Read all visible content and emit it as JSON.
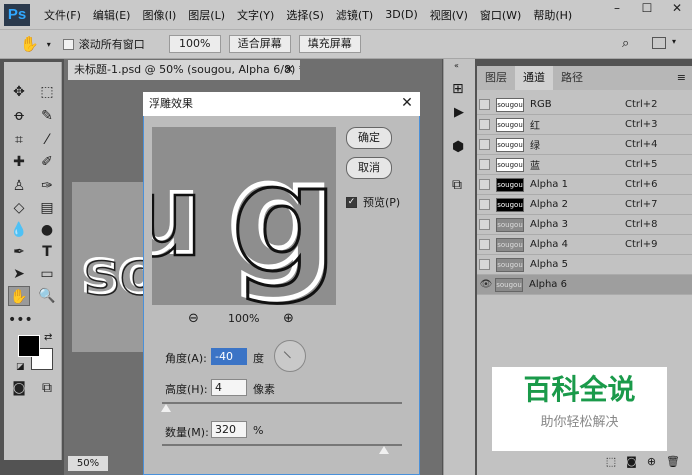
{
  "menubar": {
    "logo": "Ps",
    "items": [
      "文件(F)",
      "编辑(E)",
      "图像(I)",
      "图层(L)",
      "文字(Y)",
      "选择(S)",
      "滤镜(T)",
      "3D(D)",
      "视图(V)",
      "窗口(W)",
      "帮助(H)"
    ],
    "window_controls": {
      "minimize": "–",
      "maximize": "☐",
      "close": "✕"
    }
  },
  "options_bar": {
    "scroll_all_label": "滚动所有窗口",
    "zoom_value": "100%",
    "fit_screen": "适合屏幕",
    "fill_screen": "填充屏幕"
  },
  "document": {
    "tab_title": "未标题-1.psd @ 50% (sougou, Alpha 6/8) *",
    "zoom_status": "50%"
  },
  "channels_panel": {
    "tabs": [
      "图层",
      "通道",
      "路径"
    ],
    "active_tab": "通道",
    "channels": [
      {
        "name": "RGB",
        "shortcut": "Ctrl+2",
        "thumb": "sougou"
      },
      {
        "name": "红",
        "shortcut": "Ctrl+3",
        "thumb": "sougou"
      },
      {
        "name": "绿",
        "shortcut": "Ctrl+4",
        "thumb": "sougou"
      },
      {
        "name": "蓝",
        "shortcut": "Ctrl+5",
        "thumb": "sougou"
      },
      {
        "name": "Alpha 1",
        "shortcut": "Ctrl+6",
        "thumb": "sougou"
      },
      {
        "name": "Alpha 2",
        "shortcut": "Ctrl+7",
        "thumb": "sougou"
      },
      {
        "name": "Alpha 3",
        "shortcut": "Ctrl+8",
        "thumb": "sougou"
      },
      {
        "name": "Alpha 4",
        "shortcut": "Ctrl+9",
        "thumb": "sougou"
      },
      {
        "name": "Alpha 5",
        "shortcut": "",
        "thumb": "sougou"
      },
      {
        "name": "Alpha 6",
        "shortcut": "",
        "thumb": "sougou"
      }
    ]
  },
  "emboss_dialog": {
    "title": "浮雕效果",
    "ok_label": "确定",
    "cancel_label": "取消",
    "preview_label": "预览(P)",
    "zoom_percent": "100%",
    "angle_label": "角度(A):",
    "angle_value": "-40",
    "angle_unit": "度",
    "height_label": "高度(H):",
    "height_value": "4",
    "height_unit": "像素",
    "amount_label": "数量(M):",
    "amount_value": "320",
    "amount_unit": "%"
  },
  "watermark": {
    "main": "百科全说",
    "sub": "助你轻松解决"
  }
}
